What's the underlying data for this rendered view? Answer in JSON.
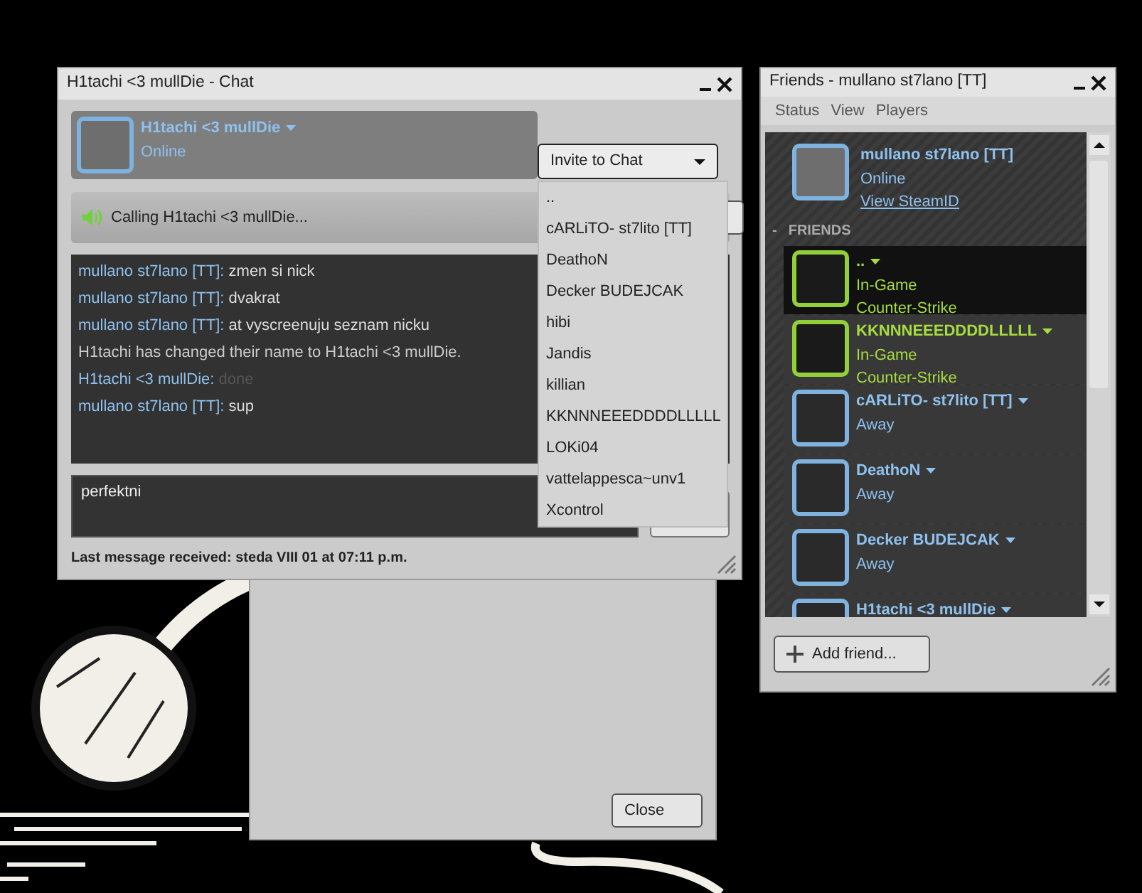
{
  "chat_window": {
    "title": "H1tachi <3 mullDie - Chat",
    "contact": {
      "name": "H1tachi <3 mullDie",
      "status": "Online"
    },
    "invite": {
      "label": "Invite to Chat",
      "expanded": true,
      "options": [
        "..",
        "cARLiTO- st7lito [TT]",
        "DeathoN",
        "Decker BUDEJCAK",
        "hibi",
        "Jandis",
        "killian",
        "KKNNNEEEDDDDLLLLL",
        "LOKi04",
        "vattelappesca~unv1",
        "Xcontrol"
      ]
    },
    "call": {
      "text": "Calling H1tachi <3 mullDie..."
    },
    "messages": [
      {
        "kind": "message",
        "sender": "mullano st7lano [TT]:",
        "text": "zmen si nick",
        "faded": false
      },
      {
        "kind": "message",
        "sender": "mullano st7lano [TT]:",
        "text": "dvakrat",
        "faded": false
      },
      {
        "kind": "message",
        "sender": "mullano st7lano [TT]:",
        "text": "at vyscreenuju seznam nicku",
        "faded": false
      },
      {
        "kind": "system",
        "text": "H1tachi has changed their name to H1tachi <3 mullDie."
      },
      {
        "kind": "message",
        "sender": "H1tachi <3 mullDie:",
        "text": "done",
        "faded": true
      },
      {
        "kind": "message",
        "sender": "mullano st7lano [TT]:",
        "text": "sup",
        "faded": false
      }
    ],
    "input": {
      "value": "perfektni"
    },
    "status": "Last message received: steda VIII 01 at 07:11 p.m."
  },
  "back_window": {
    "button": "Close"
  },
  "friends_window": {
    "title": "Friends - mullano st7lano [TT]",
    "menu": [
      "Status",
      "View",
      "Players"
    ],
    "self": {
      "name": "mullano st7lano [TT]",
      "status": "Online",
      "link": "View SteamID"
    },
    "group": {
      "toggle": "-",
      "label": "FRIENDS"
    },
    "friends": [
      {
        "name": "..",
        "kind": "in-game",
        "status": "In-Game",
        "game": "Counter-Strike",
        "selected": true
      },
      {
        "name": "KKNNNEEEDDDDLLLLL",
        "kind": "in-game",
        "status": "In-Game",
        "game": "Counter-Strike",
        "selected": false
      },
      {
        "name": "cARLiTO- st7lito [TT]",
        "kind": "away",
        "status": "Away",
        "selected": false
      },
      {
        "name": "DeathoN",
        "kind": "away",
        "status": "Away",
        "selected": false
      },
      {
        "name": "Decker BUDEJCAK",
        "kind": "away",
        "status": "Away",
        "selected": false
      },
      {
        "name": "H1tachi <3 mullDie",
        "kind": "away",
        "selected": false
      }
    ],
    "add_button": "Add friend..."
  }
}
